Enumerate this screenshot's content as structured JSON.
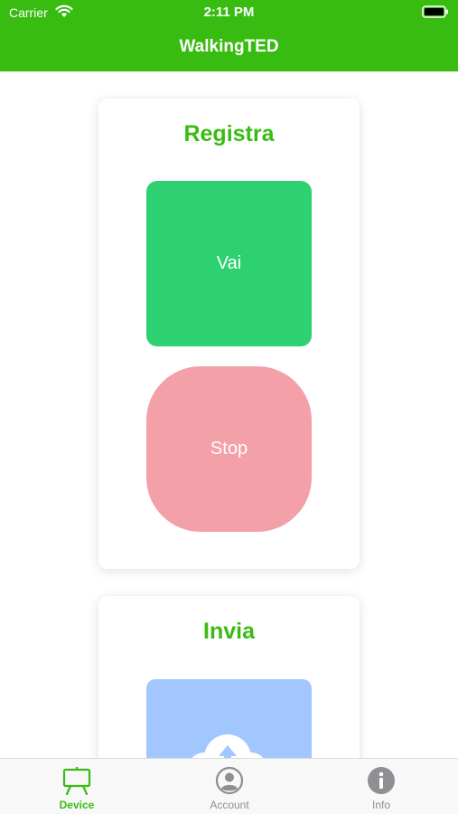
{
  "status_bar": {
    "carrier": "Carrier",
    "time": "2:11 PM",
    "icons": [
      "wifi-icon",
      "battery-icon"
    ]
  },
  "nav": {
    "title": "WalkingTED"
  },
  "register_card": {
    "title": "Registra",
    "go_label": "Vai",
    "stop_label": "Stop"
  },
  "send_card": {
    "title": "Invia",
    "upload_icon": "cloud-upload-icon"
  },
  "tabs": [
    {
      "label": "Device",
      "icon": "easel-icon",
      "active": true
    },
    {
      "label": "Account",
      "icon": "person-circle-icon",
      "active": false
    },
    {
      "label": "Info",
      "icon": "info-circle-icon",
      "active": false
    }
  ],
  "colors": {
    "brand_green": "#39bc12",
    "go_button": "#2ed172",
    "stop_button": "#f3a0a9",
    "upload_button": "#a2c6fe",
    "tab_inactive": "#8e8e93"
  }
}
